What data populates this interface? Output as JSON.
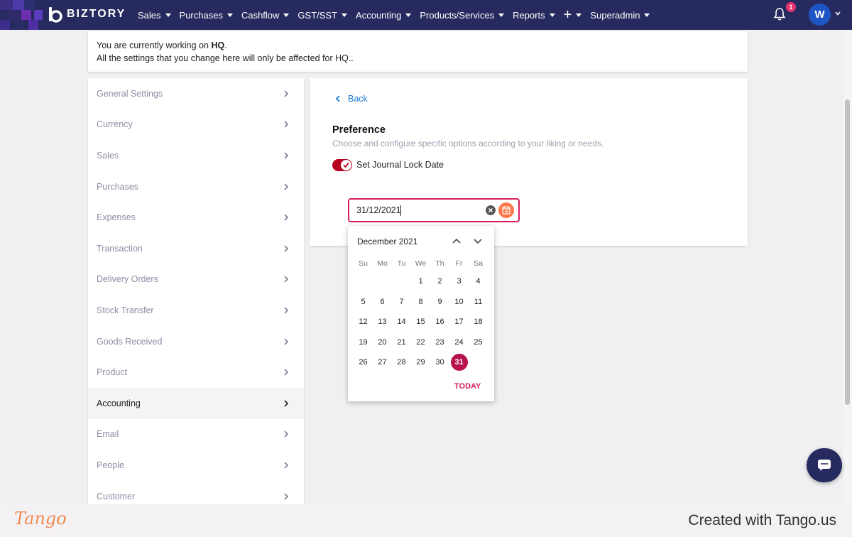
{
  "topbar": {
    "brand": "BIZTORY",
    "nav": [
      {
        "label": "Sales"
      },
      {
        "label": "Purchases"
      },
      {
        "label": "Cashflow"
      },
      {
        "label": "GST/SST"
      },
      {
        "label": "Accounting"
      },
      {
        "label": "Products/Services"
      },
      {
        "label": "Reports"
      },
      {
        "label": "+"
      },
      {
        "label": "Superadmin"
      }
    ],
    "notification_count": "1",
    "avatar_initial": "W"
  },
  "info": {
    "line1_prefix": "You are currently working on ",
    "line1_location": "HQ",
    "line1_suffix": ".",
    "line2": "All the settings that you change here will only be affected for HQ.."
  },
  "sidebar": {
    "items": [
      {
        "label": "General Settings"
      },
      {
        "label": "Currency"
      },
      {
        "label": "Sales"
      },
      {
        "label": "Purchases"
      },
      {
        "label": "Expenses"
      },
      {
        "label": "Transaction"
      },
      {
        "label": "Delivery Orders"
      },
      {
        "label": "Stock Transfer"
      },
      {
        "label": "Goods Received"
      },
      {
        "label": "Product"
      },
      {
        "label": "Accounting",
        "active": true
      },
      {
        "label": "Email"
      },
      {
        "label": "People"
      },
      {
        "label": "Customer"
      }
    ]
  },
  "main": {
    "back_label": "Back",
    "title": "Preference",
    "subtitle": "Choose and configure specific options according to your liking or needs.",
    "toggle_label": "Set Journal Lock Date",
    "toggle_on": true,
    "date_value": "31/12/2021"
  },
  "calendar": {
    "month_label": "December 2021",
    "weekdays": [
      "Su",
      "Mo",
      "Tu",
      "We",
      "Th",
      "Fr",
      "Sa"
    ],
    "first_weekday_index": 3,
    "days_in_month": 31,
    "selected_day": 31,
    "today_label": "TODAY"
  },
  "footer": {
    "logo": "Tango",
    "credit": "Created with Tango.us"
  },
  "colors": {
    "nav_bg": "#262a5e",
    "accent": "#d81b60",
    "toggle": "#b8001f",
    "link": "#1d7bd1",
    "tango_orange": "#f08a52"
  },
  "icons": {
    "back": "chevron-left-icon",
    "sidebar_chevron": "chevron-right-icon",
    "bell": "bell-icon",
    "clear": "clear-circle-icon",
    "calendar": "calendar-icon",
    "chat": "chat-icon"
  }
}
